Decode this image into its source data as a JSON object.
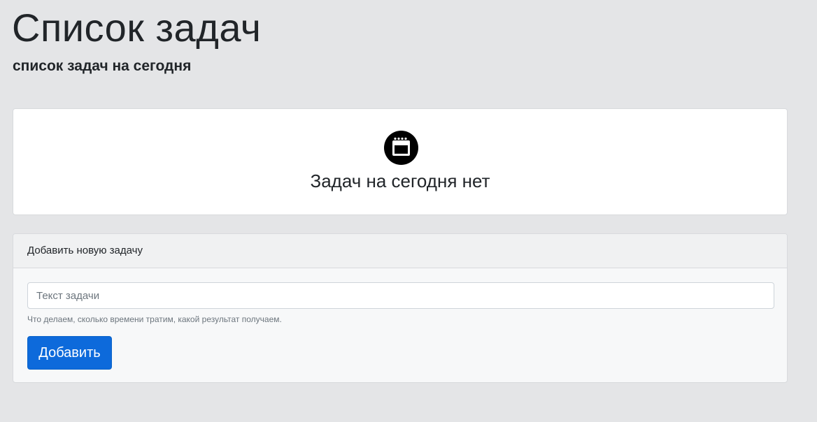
{
  "header": {
    "title": "Список задач",
    "subtitle": "список задач на сегодня"
  },
  "empty_state": {
    "icon": "calendar-icon",
    "message": "Задач на сегодня нет"
  },
  "add_task": {
    "title": "Добавить новую задачу",
    "input_placeholder": "Текст задачи",
    "input_value": "",
    "help_text": "Что делаем, сколько времени тратим, какой результат получаем.",
    "button_label": "Добавить"
  },
  "colors": {
    "page_background": "#e4e5e7",
    "primary_button": "#0d6adb",
    "card_background": "#ffffff"
  }
}
